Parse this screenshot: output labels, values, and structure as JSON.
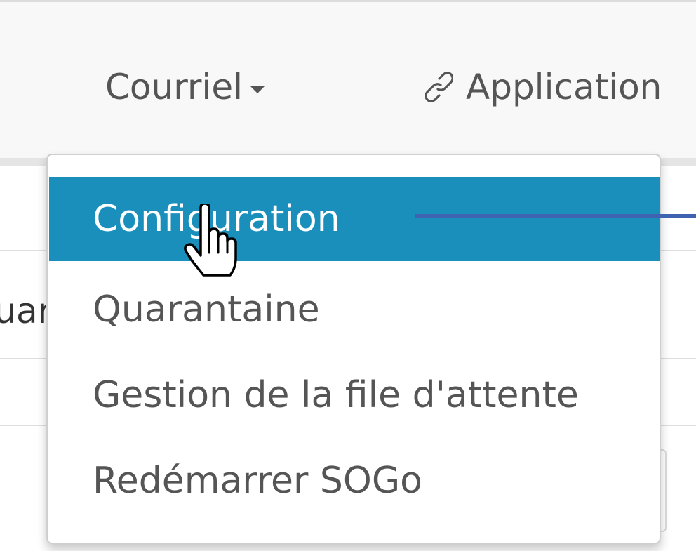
{
  "navbar": {
    "courriel_label": "Courriel",
    "courriel_caret_icon": "caret-down-icon",
    "applications_icon": "link-icon",
    "applications_label": "Application"
  },
  "page": {
    "fragment_text": "Quar"
  },
  "dropdown": {
    "items": [
      {
        "label": "Configuration",
        "active": true
      },
      {
        "label": "Quarantaine",
        "active": false
      },
      {
        "label": "Gestion de la file d'attente",
        "active": false
      },
      {
        "label": "Redémarrer SOGo",
        "active": false
      }
    ]
  },
  "cursor": {
    "icon": "hand-pointer-icon"
  },
  "colors": {
    "active_bg": "#1a8fbc",
    "menu_text": "#555555",
    "navbar_bg": "#f8f8f8",
    "annotation_line": "#3f63b0"
  }
}
